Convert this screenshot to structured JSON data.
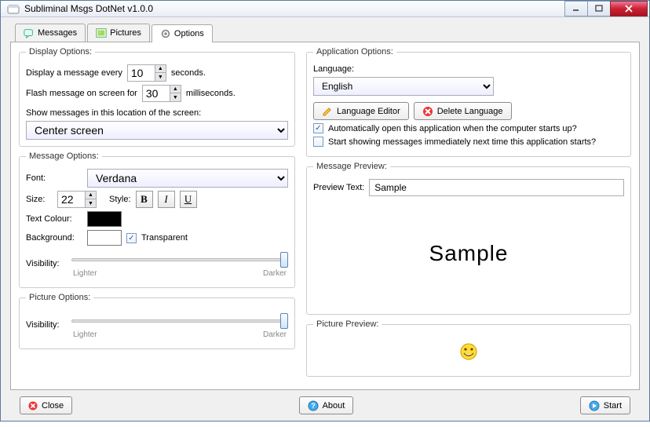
{
  "window": {
    "title": "Subliminal Msgs DotNet v1.0.0"
  },
  "tabs": {
    "messages": "Messages",
    "pictures": "Pictures",
    "options": "Options"
  },
  "display": {
    "legend": "Display Options:",
    "every_prefix": "Display a message every",
    "every_value": "10",
    "every_suffix": "seconds.",
    "flash_prefix": "Flash message on screen for",
    "flash_value": "30",
    "flash_suffix": "milliseconds.",
    "loc_label": "Show messages in this location of the screen:",
    "loc_value": "Center screen"
  },
  "msgopt": {
    "legend": "Message Options:",
    "font_label": "Font:",
    "font_value": "Verdana",
    "size_label": "Size:",
    "size_value": "22",
    "style_label": "Style:",
    "b": "B",
    "i": "I",
    "u": "U",
    "tcolor_label": "Text Colour:",
    "tcolor_hex": "#000000",
    "bg_label": "Background:",
    "bg_hex": "#ffffff",
    "transparent_label": "Transparent",
    "vis_label": "Visibility:",
    "vis_lighter": "Lighter",
    "vis_darker": "Darker"
  },
  "picopt": {
    "legend": "Picture Options:",
    "vis_label": "Visibility:",
    "vis_lighter": "Lighter",
    "vis_darker": "Darker"
  },
  "appopt": {
    "legend": "Application Options:",
    "lang_label": "Language:",
    "lang_value": "English",
    "editor_btn": "Language Editor",
    "delete_btn": "Delete Language",
    "auto_open": "Automatically open this application when the computer starts up?",
    "start_showing": "Start showing messages immediately next time this application starts?"
  },
  "preview": {
    "legend": "Message Preview:",
    "text_label": "Preview Text:",
    "text_value": "Sample",
    "sample_display": "Sample"
  },
  "picpreview": {
    "legend": "Picture Preview:"
  },
  "footer": {
    "close": "Close",
    "about": "About",
    "start": "Start"
  }
}
